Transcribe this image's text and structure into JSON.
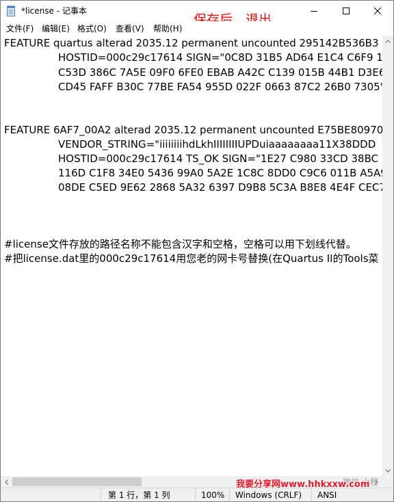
{
  "window": {
    "title": "*license - 记事本",
    "annotation": "保存后，退出"
  },
  "icons": {
    "app": "notepad-icon",
    "minimize": "minimize-icon",
    "maximize": "maximize-icon",
    "close": "close-icon"
  },
  "menu": {
    "items": [
      "文件(F)",
      "编辑(E)",
      "格式(O)",
      "查看(V)",
      "帮助(H)"
    ]
  },
  "editor": {
    "lines": [
      "FEATURE quartus alterad 2035.12 permanent uncounted 295142B536B3",
      "HOSTID=000c29c17614 SIGN=\"0C8D 31B5 AD64 E1C4 C6F9 1",
      "C53D 386C 7A5E 09F0 6FE0 EBAB A42C C139 015B 44B1 D3E6",
      "CD45 FAFF B30C 77BE FA54 955D 022F 0663 87C2 26B0 7305'",
      "FEATURE 6AF7_00A2 alterad 2035.12 permanent uncounted E75BE80970",
      "VENDOR_STRING=\"iiiiiiiihdLkhIIIIIIIIUPDuiaaaaaaaa11X38DDD",
      "HOSTID=000c29c17614 TS_OK SIGN=\"1E27 C980 33CD 38BC",
      "116D C1F8 34E0 5436 99A0 5A2E 1C8C 8DD0 C9C6 011B A5A9",
      "08DE C5ED 9E62 2868 5A32 6397 D9B8 5C3A B8E8 4E4F CEC7",
      "#license文件存放的路径名称不能包含汉字和空格，空格可以用下划线代替。",
      "#把license.dat里的000c29c17614用您老的网卡号替换(在Quartus II的Tools菜"
    ]
  },
  "status": {
    "position": "第 1 行，第 1 列",
    "zoom": "100%",
    "line_ending": "Windows (CRLF)",
    "encoding": "ANSI"
  },
  "watermark": {
    "text": "我要分享网www.hhkxxw.com",
    "sub": "微信 小程"
  }
}
